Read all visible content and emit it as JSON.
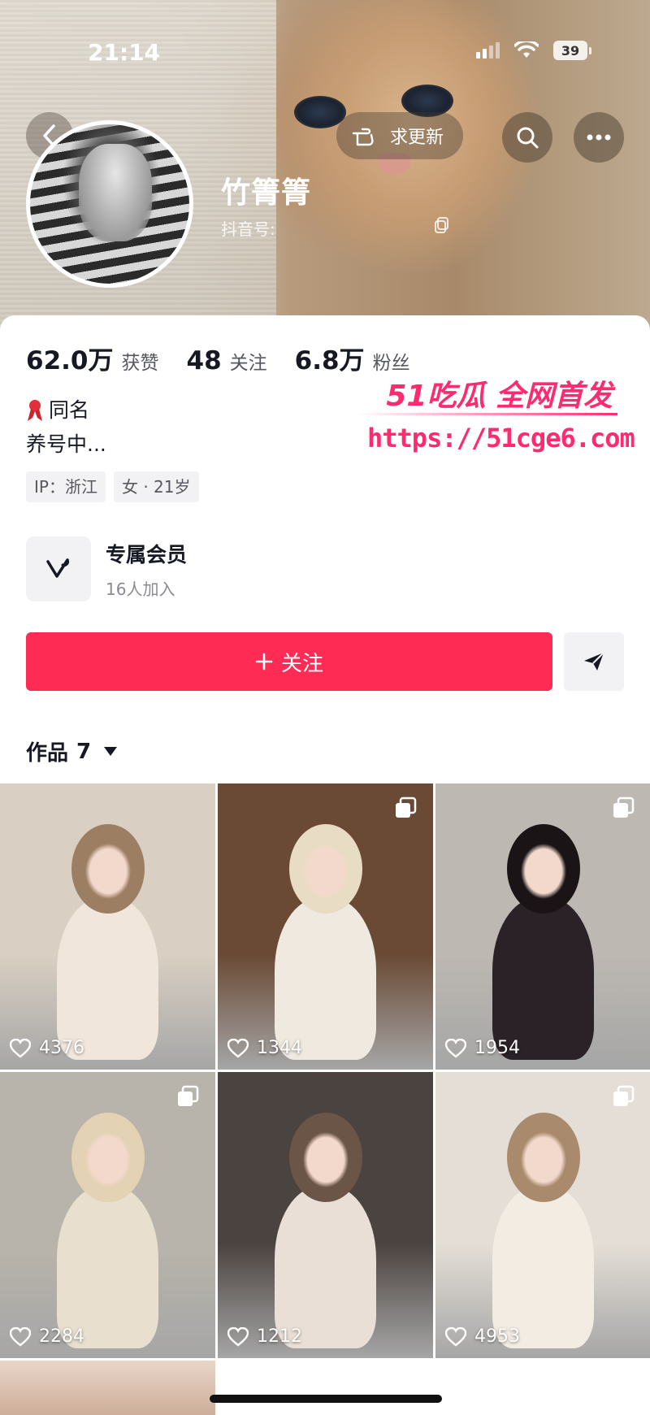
{
  "status_bar": {
    "time": "21:14",
    "battery": "39"
  },
  "header": {
    "want_update_label": "求更新",
    "profile_name": "竹箐箐",
    "douyin_id_label": "抖音号:"
  },
  "stats": [
    {
      "value": "62.0万",
      "label": "获赞"
    },
    {
      "value": "48",
      "label": "关注"
    },
    {
      "value": "6.8万",
      "label": "粉丝"
    }
  ],
  "bio": {
    "line1": "同名",
    "line2": "养号中..."
  },
  "tags": [
    "IP：浙江",
    "女 · 21岁"
  ],
  "watermark": {
    "brand": "51吃瓜 全网首发",
    "url": "https://51cge6.com"
  },
  "member": {
    "title": "专属会员",
    "subtitle": "16人加入"
  },
  "actions": {
    "follow_label": "关注"
  },
  "works": {
    "label": "作品",
    "count": "7"
  },
  "videos": [
    {
      "likes": "4376",
      "multi": false,
      "bg": "#d9cfc2",
      "fig": "#f1e6dc",
      "hair": "#9c7f63"
    },
    {
      "likes": "1344",
      "multi": true,
      "bg": "#6a4a35",
      "fig": "#efe9df",
      "hair": "#e9dcc4"
    },
    {
      "likes": "1954",
      "multi": true,
      "bg": "#bdb8b2",
      "fig": "#2a2226",
      "hair": "#1a1416"
    },
    {
      "likes": "2284",
      "multi": true,
      "bg": "#b9b4ab",
      "fig": "#e8dfcf",
      "hair": "#e4d2b4"
    },
    {
      "likes": "1212",
      "multi": false,
      "bg": "#4b4340",
      "fig": "#eadfd6",
      "hair": "#6b5546"
    },
    {
      "likes": "4953",
      "multi": true,
      "bg": "#e4ded6",
      "fig": "#f2ece3",
      "hair": "#a98a6c"
    }
  ],
  "colors": {
    "accent": "#fe2c55",
    "watermark": "#ff2b6e"
  }
}
